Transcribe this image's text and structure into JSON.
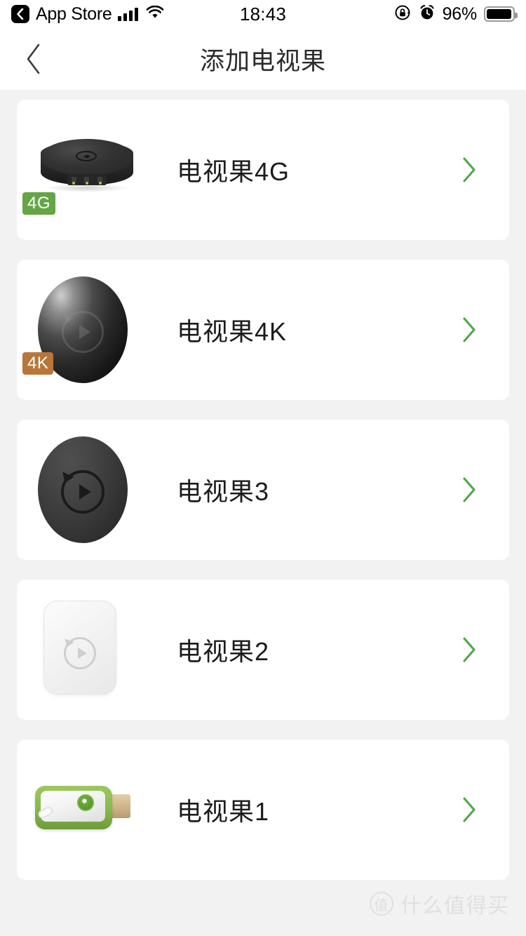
{
  "status_bar": {
    "carrier_back_label": "App Store",
    "time": "18:43",
    "battery_percent": "96%",
    "signal_icon": "cellular-signal-icon",
    "wifi_icon": "wifi-icon",
    "rotation_lock_icon": "rotation-lock-icon",
    "alarm_icon": "alarm-clock-icon",
    "battery_icon": "battery-icon"
  },
  "navbar": {
    "back_icon": "chevron-left-icon",
    "title": "添加电视果"
  },
  "colors": {
    "page_background": "#f2f2f2",
    "card_background": "#ffffff",
    "chevron_green": "#4ca845",
    "badge_4g_green": "#64a545",
    "badge_4k_bronze": "#b8763a",
    "title_text": "#2b2b2b",
    "item_text": "#1c1c1c",
    "watermark": "#e0e0e0"
  },
  "devices": [
    {
      "name": "电视果4G",
      "badge": "4G",
      "badge_color": "#64a545",
      "image_icon": "tvguo-4g-puck-device-image",
      "chevron_icon": "chevron-right-icon"
    },
    {
      "name": "电视果4K",
      "badge": "4K",
      "badge_color": "#b8763a",
      "image_icon": "tvguo-4k-sphere-device-image",
      "chevron_icon": "chevron-right-icon"
    },
    {
      "name": "电视果3",
      "badge": "",
      "badge_color": "",
      "image_icon": "tvguo-3-egg-device-image",
      "chevron_icon": "chevron-right-icon"
    },
    {
      "name": "电视果2",
      "badge": "",
      "badge_color": "",
      "image_icon": "tvguo-2-white-box-device-image",
      "chevron_icon": "chevron-right-icon"
    },
    {
      "name": "电视果1",
      "badge": "",
      "badge_color": "",
      "image_icon": "tvguo-1-hdmi-dongle-device-image",
      "chevron_icon": "chevron-right-icon"
    }
  ],
  "watermark": {
    "logo_char": "值",
    "text": "什么值得买"
  }
}
